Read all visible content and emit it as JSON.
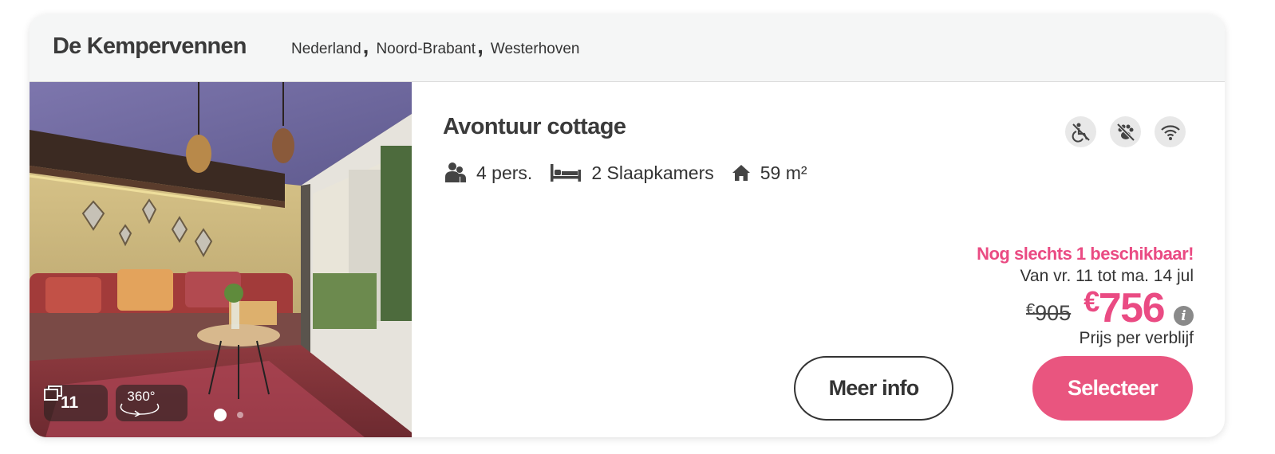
{
  "header": {
    "park_name": "De Kempervennen",
    "location": [
      "Nederland",
      "Noord-Brabant",
      "Westerhoven"
    ],
    "separator": ","
  },
  "photo": {
    "photo_count": "11",
    "tour_label": "360°",
    "carousel_dots": 2,
    "active_dot": 0
  },
  "accommodation": {
    "name": "Avontuur cottage",
    "amenity_icons": [
      "no-wheelchair-icon",
      "no-pets-icon",
      "wifi-icon"
    ],
    "features": {
      "persons": "4 pers.",
      "bedrooms": "2 Slaapkamers",
      "area": "59 m²"
    }
  },
  "pricing": {
    "availability": "Nog slechts 1 beschikbaar!",
    "dates": "Van vr. 11 tot ma. 14 jul",
    "currency": "€",
    "old_price": "905",
    "new_price": "756",
    "info_glyph": "i",
    "price_note": "Prijs per verblijf"
  },
  "actions": {
    "more_info_label": "Meer info",
    "select_label": "Selecteer"
  },
  "colors": {
    "accent": "#ea4b83",
    "select_button": "#e9557f",
    "header_bg": "#f5f6f6"
  }
}
